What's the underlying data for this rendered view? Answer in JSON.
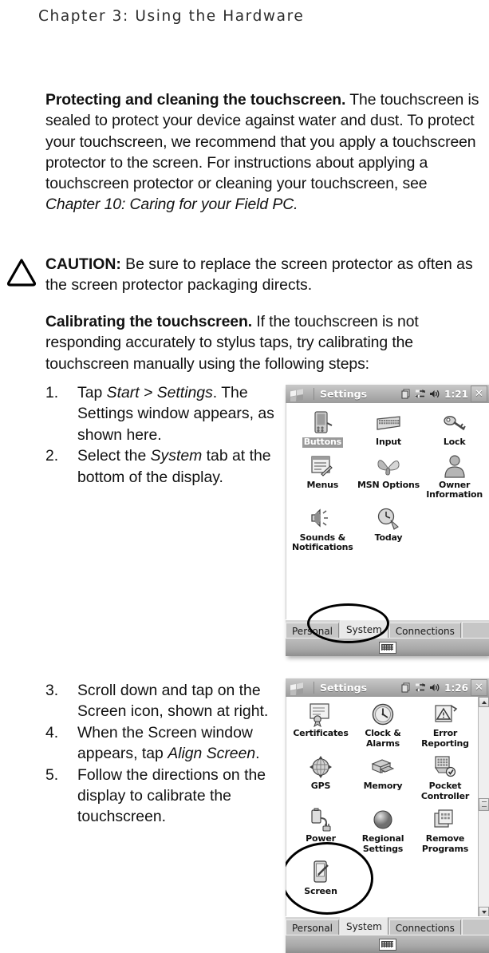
{
  "header": {
    "running_head": "Chapter 3:  Using the Hardware"
  },
  "body": {
    "para1": {
      "lead": "Protecting and cleaning the touchscreen.",
      "text": " The touchscreen is sealed to protect your device against water and dust. To protect your touchscreen, we recommend that you apply a touchscreen protector to the screen. For instructions about applying a touchscreen protector or cleaning your touchscreen, see ",
      "italic_ref": "Chapter 10: Caring for your Field PC."
    },
    "caution": {
      "icon": "warning-triangle-icon",
      "lead": "CAUTION:",
      "text": " Be sure to replace the screen protector as often as the screen protector packaging directs."
    },
    "para2": {
      "lead": "Calibrating the touchscreen.",
      "text": " If the touchscreen is not responding accurately to stylus taps, try calibrating the touchscreen manually using the following steps:"
    }
  },
  "steps_group_a": [
    {
      "num": "1.",
      "pre": "Tap ",
      "italic": "Start > Settings",
      "post": ". The Settings window appears, as shown here."
    },
    {
      "num": "2.",
      "pre": "Select the ",
      "italic": "System",
      "post": " tab at the bottom of the display."
    }
  ],
  "steps_group_b": [
    {
      "num": "3.",
      "pre": "Scroll down and tap on the Screen icon, shown at right.",
      "italic": "",
      "post": ""
    },
    {
      "num": "4.",
      "pre": "When the Screen window appears, tap ",
      "italic": "Align Screen",
      "post": "."
    },
    {
      "num": "5.",
      "pre": "Follow the directions on the display to calibrate the touchscreen.",
      "italic": "",
      "post": ""
    }
  ],
  "pda_personal": {
    "titlebar": {
      "start_icon": "windows-flag-icon",
      "title": "Settings",
      "icons": [
        "copy-icon",
        "network-connect-icon",
        "speaker-icon"
      ],
      "time": "1:21",
      "close_label": "✕"
    },
    "items": [
      {
        "label": "Buttons",
        "icon": "buttons-icon",
        "selected": true
      },
      {
        "label": "Input",
        "icon": "keyboard-icon",
        "selected": false
      },
      {
        "label": "Lock",
        "icon": "lock-key-icon",
        "selected": false
      },
      {
        "label": "Menus",
        "icon": "menus-icon",
        "selected": false
      },
      {
        "label": "MSN Options",
        "icon": "msn-butterfly-icon",
        "selected": false
      },
      {
        "label": "Owner Information",
        "icon": "owner-person-icon",
        "selected": false
      },
      {
        "label": "Sounds & Notifications",
        "icon": "speaker-sound-icon",
        "selected": false
      },
      {
        "label": "Today",
        "icon": "today-clock-icon",
        "selected": false
      }
    ],
    "tabs": [
      {
        "label": "Personal",
        "active": false
      },
      {
        "label": "System",
        "active": true
      },
      {
        "label": "Connections",
        "active": false
      }
    ],
    "toolbar_icon": "sip-keyboard-icon",
    "annotation": "ellipse-highlight-system-tab"
  },
  "pda_system": {
    "titlebar": {
      "start_icon": "windows-flag-icon",
      "title": "Settings",
      "icons": [
        "copy-icon",
        "network-connect-icon",
        "speaker-icon"
      ],
      "time": "1:26",
      "close_label": "✕"
    },
    "items": [
      {
        "label": "Certificates",
        "icon": "certificate-icon"
      },
      {
        "label": "Clock & Alarms",
        "icon": "clock-icon"
      },
      {
        "label": "Error Reporting",
        "icon": "error-reporting-icon"
      },
      {
        "label": "GPS",
        "icon": "gps-icon"
      },
      {
        "label": "Memory",
        "icon": "memory-icon"
      },
      {
        "label": "Pocket Controller",
        "icon": "pocket-controller-icon"
      },
      {
        "label": "Power",
        "icon": "power-battery-icon"
      },
      {
        "label": "Regional Settings",
        "icon": "regional-globe-icon"
      },
      {
        "label": "Remove Programs",
        "icon": "remove-programs-icon"
      },
      {
        "label": "Screen",
        "icon": "screen-stylus-icon"
      }
    ],
    "tabs": [
      {
        "label": "Personal",
        "active": false
      },
      {
        "label": "System",
        "active": true
      },
      {
        "label": "Connections",
        "active": false
      }
    ],
    "scrollbar": {
      "up": "scroll-up-arrow",
      "down": "scroll-down-arrow"
    },
    "toolbar_icon": "sip-keyboard-icon",
    "annotation": "ellipse-highlight-screen-icon"
  },
  "colors": {
    "page_bg": "#ffffff",
    "text": "#111111",
    "titlebar_gray": "#b4b4b4",
    "toolbar_gray": "#a8a8a8",
    "annotation": "#000000"
  }
}
